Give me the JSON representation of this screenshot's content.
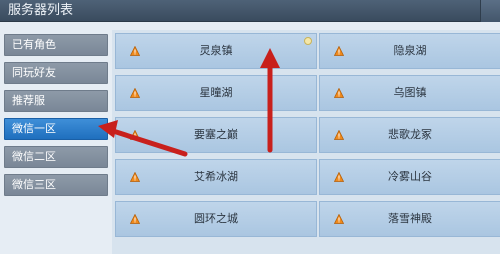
{
  "header": {
    "title": "服务器列表"
  },
  "sidebar": {
    "items": [
      {
        "label": "已有角色"
      },
      {
        "label": "同玩好友"
      },
      {
        "label": "推荐服"
      },
      {
        "label": "微信一区"
      },
      {
        "label": "微信二区"
      },
      {
        "label": "微信三区"
      }
    ],
    "active_index": 3
  },
  "servers": {
    "left": [
      "灵泉镇",
      "星曈湖",
      "要塞之巅",
      "艾希冰湖",
      "圆环之城"
    ],
    "right": [
      "隐泉湖",
      "乌图镇",
      "悲歌龙冢",
      "冷雾山谷",
      "落雪神殿"
    ]
  },
  "colors": {
    "header_bg": "#3f5165",
    "sidebar_item": "#8492a1",
    "sidebar_active": "#2b7bcc",
    "server_tile": "#b5cee6",
    "warning_icon": "#f08a1c",
    "annotation_arrow": "#c8201c"
  },
  "icons": [
    "warning-triangle-icon",
    "new-badge-icon",
    "red-arrow-annotation"
  ]
}
